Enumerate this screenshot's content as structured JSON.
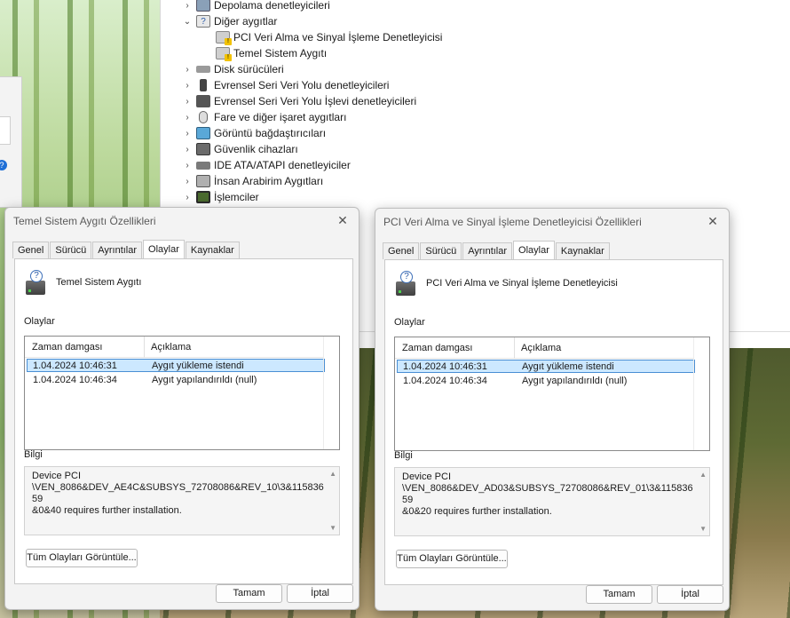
{
  "device_manager": {
    "items": [
      {
        "label": "Depolama denetleyicileri",
        "expanded": false,
        "level": 0,
        "icon": "storage-controller-icon"
      },
      {
        "label": "Diğer aygıtlar",
        "expanded": true,
        "level": 0,
        "icon": "unknown-device-icon"
      },
      {
        "label": "PCI Veri Alma ve Sinyal İşleme Denetleyicisi",
        "level": 1,
        "icon": "warning-device-icon"
      },
      {
        "label": "Temel Sistem Aygıtı",
        "level": 1,
        "icon": "warning-device-icon"
      },
      {
        "label": "Disk sürücüleri",
        "expanded": false,
        "level": 0,
        "icon": "disk-drive-icon"
      },
      {
        "label": "Evrensel Seri Veri Yolu denetleyicileri",
        "expanded": false,
        "level": 0,
        "icon": "usb-icon"
      },
      {
        "label": "Evrensel Seri Veri Yolu İşlevi denetleyicileri",
        "expanded": false,
        "level": 0,
        "icon": "usb-function-icon"
      },
      {
        "label": "Fare ve diğer işaret aygıtları",
        "expanded": false,
        "level": 0,
        "icon": "mouse-icon"
      },
      {
        "label": "Görüntü bağdaştırıcıları",
        "expanded": false,
        "level": 0,
        "icon": "display-adapter-icon"
      },
      {
        "label": "Güvenlik cihazları",
        "expanded": false,
        "level": 0,
        "icon": "security-device-icon"
      },
      {
        "label": "IDE ATA/ATAPI denetleyiciler",
        "expanded": false,
        "level": 0,
        "icon": "ide-controller-icon"
      },
      {
        "label": "İnsan Arabirim Aygıtları",
        "expanded": false,
        "level": 0,
        "icon": "hid-icon"
      },
      {
        "label": "İşlemciler",
        "expanded": false,
        "level": 0,
        "icon": "processor-icon"
      }
    ],
    "partial_text": "ri"
  },
  "dialogs": [
    {
      "title": "Temel Sistem Aygıtı Özellikleri",
      "tabs": [
        "Genel",
        "Sürücü",
        "Ayrıntılar",
        "Olaylar",
        "Kaynaklar"
      ],
      "active_tab": "Olaylar",
      "device_name": "Temel Sistem Aygıtı",
      "events_label": "Olaylar",
      "columns": [
        "Zaman damgası",
        "Açıklama"
      ],
      "rows": [
        {
          "time": "1.04.2024 10:46:31",
          "desc": "Aygıt yükleme istendi",
          "selected": true
        },
        {
          "time": "1.04.2024 10:46:34",
          "desc": "Aygıt yapılandırıldı (null)",
          "selected": false
        }
      ],
      "info_label": "Bilgi",
      "info_text": "Device PCI\n\\VEN_8086&DEV_AE4C&SUBSYS_72708086&REV_10\\3&11583659\n&0&40 requires further installation.",
      "view_all_button": "Tüm Olayları Görüntüle...",
      "ok_button": "Tamam",
      "cancel_button": "İptal"
    },
    {
      "title": "PCI Veri Alma ve Sinyal İşleme Denetleyicisi Özellikleri",
      "tabs": [
        "Genel",
        "Sürücü",
        "Ayrıntılar",
        "Olaylar",
        "Kaynaklar"
      ],
      "active_tab": "Olaylar",
      "device_name": "PCI Veri Alma ve Sinyal İşleme Denetleyicisi",
      "events_label": "Olaylar",
      "columns": [
        "Zaman damgası",
        "Açıklama"
      ],
      "rows": [
        {
          "time": "1.04.2024 10:46:31",
          "desc": "Aygıt yükleme istendi",
          "selected": true
        },
        {
          "time": "1.04.2024 10:46:34",
          "desc": "Aygıt yapılandırıldı (null)",
          "selected": false
        }
      ],
      "info_label": "Bilgi",
      "info_text": "Device PCI\n\\VEN_8086&DEV_AD03&SUBSYS_72708086&REV_01\\3&11583659\n&0&20 requires further installation.",
      "view_all_button": "Tüm Olayları Görüntüle...",
      "ok_button": "Tamam",
      "cancel_button": "İptal"
    }
  ],
  "colors": {
    "selection": "#cce8ff",
    "selection_border": "#4a8fd4",
    "dialog_bg": "#f3f3f3",
    "warning": "#f2c200"
  },
  "glyphs": {
    "close": "✕",
    "chev_right": "›",
    "chev_down": "⌄",
    "question": "?",
    "scroll_up": "▲",
    "scroll_down": "▼"
  }
}
